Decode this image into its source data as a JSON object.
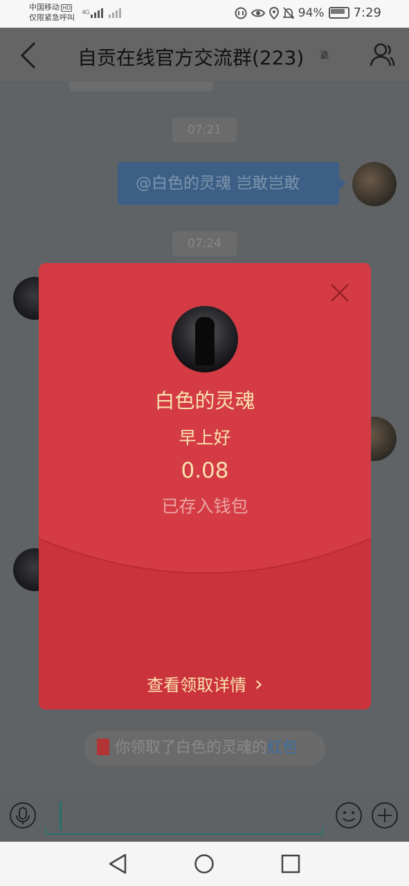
{
  "status_bar": {
    "carrier": "中国移动",
    "hd_badge": "HD",
    "emergency": "仅限紧急呼叫",
    "network": "4G",
    "battery": "94%",
    "time": "7:29"
  },
  "header": {
    "title": "自贡在线官方交流群(223)"
  },
  "chat": {
    "times": [
      "07:21",
      "07:24"
    ],
    "my_message": "@白色的灵魂 岂敢岂敢",
    "notice": {
      "prefix": "你领取了白色的灵魂的",
      "link": "红包"
    }
  },
  "red_packet": {
    "sender": "白色的灵魂",
    "wish": "早上好",
    "amount": "0.08",
    "status": "已存入钱包",
    "details_link": "查看领取详情",
    "details_chevron": "›"
  },
  "colors": {
    "packet_red": "#d43b44",
    "packet_gold": "#f9e2b0",
    "overlay": "#606366"
  }
}
